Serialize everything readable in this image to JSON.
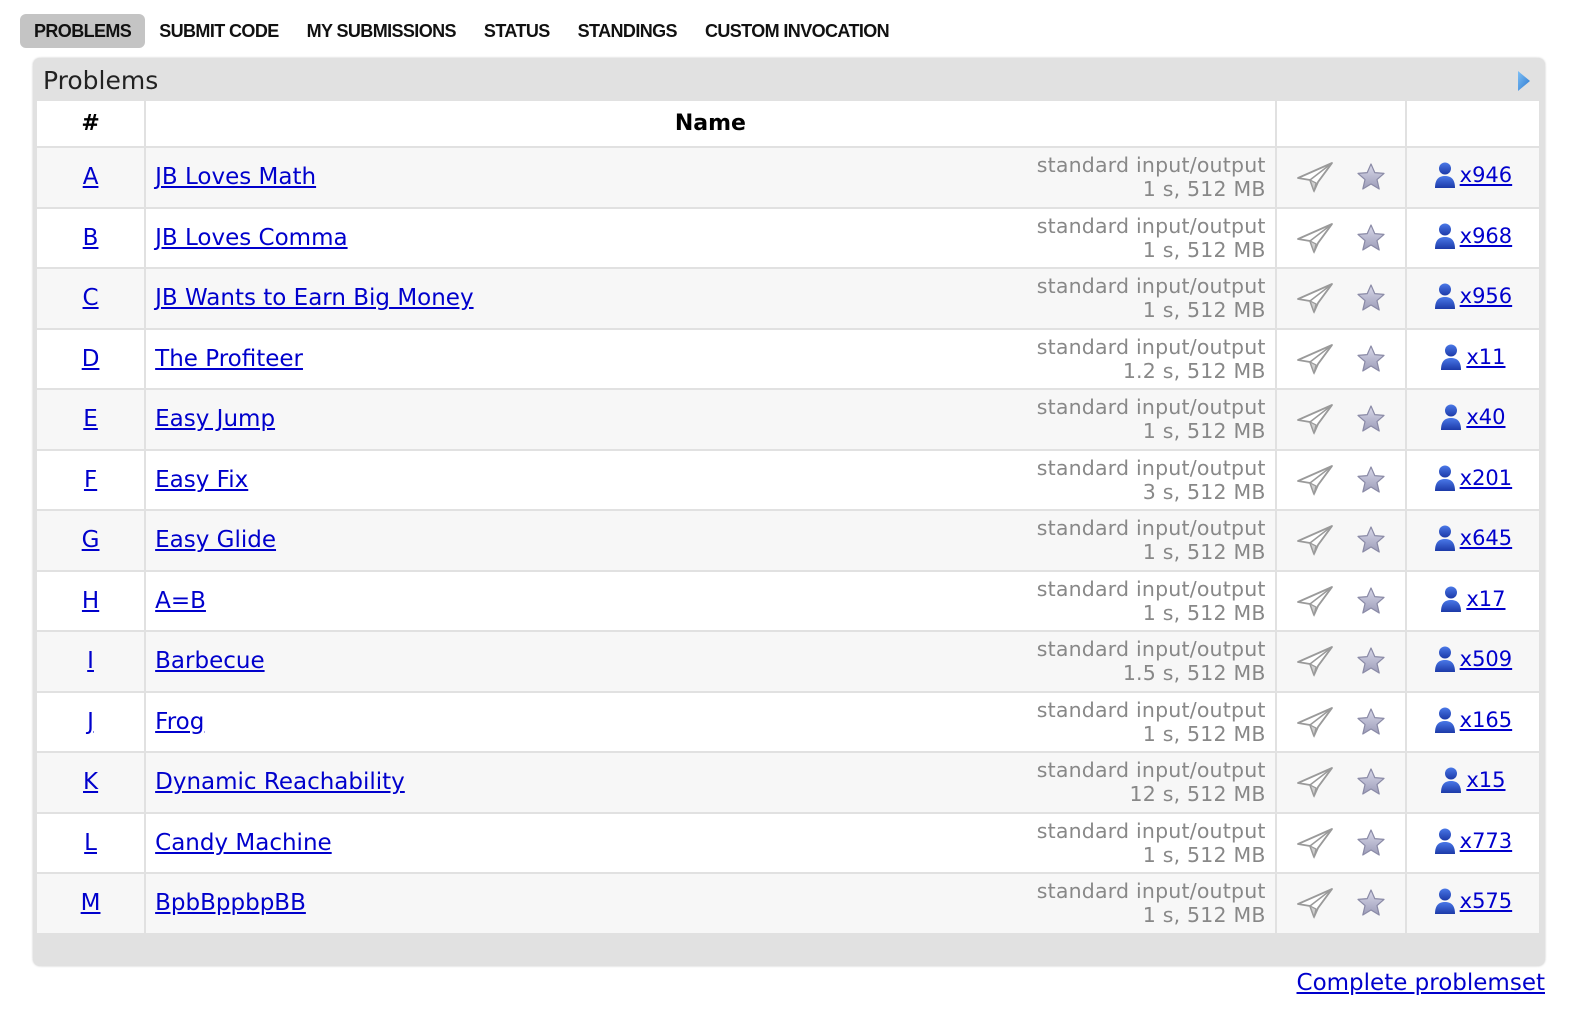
{
  "nav": {
    "items": [
      {
        "label": "PROBLEMS",
        "active": true
      },
      {
        "label": "SUBMIT CODE",
        "active": false
      },
      {
        "label": "MY SUBMISSIONS",
        "active": false
      },
      {
        "label": "STATUS",
        "active": false
      },
      {
        "label": "STANDINGS",
        "active": false
      },
      {
        "label": "CUSTOM INVOCATION",
        "active": false
      }
    ]
  },
  "panel": {
    "title": "Problems",
    "toggle_icon": "triangle-right-icon",
    "toggle_color": "#3b8ee0"
  },
  "table": {
    "headers": {
      "index": "#",
      "name": "Name",
      "actions": "",
      "solved": ""
    },
    "rows": [
      {
        "index": "A",
        "name": "JB Loves Math",
        "io": "standard input/output",
        "limits": "1 s, 512 MB",
        "solved": "x946"
      },
      {
        "index": "B",
        "name": "JB Loves Comma",
        "io": "standard input/output",
        "limits": "1 s, 512 MB",
        "solved": "x968"
      },
      {
        "index": "C",
        "name": "JB Wants to Earn Big Money",
        "io": "standard input/output",
        "limits": "1 s, 512 MB",
        "solved": "x956"
      },
      {
        "index": "D",
        "name": "The Profiteer",
        "io": "standard input/output",
        "limits": "1.2 s, 512 MB",
        "solved": "x11"
      },
      {
        "index": "E",
        "name": "Easy Jump",
        "io": "standard input/output",
        "limits": "1 s, 512 MB",
        "solved": "x40"
      },
      {
        "index": "F",
        "name": "Easy Fix",
        "io": "standard input/output",
        "limits": "3 s, 512 MB",
        "solved": "x201"
      },
      {
        "index": "G",
        "name": "Easy Glide",
        "io": "standard input/output",
        "limits": "1 s, 512 MB",
        "solved": "x645"
      },
      {
        "index": "H",
        "name": "A=B",
        "io": "standard input/output",
        "limits": "1 s, 512 MB",
        "solved": "x17"
      },
      {
        "index": "I",
        "name": "Barbecue",
        "io": "standard input/output",
        "limits": "1.5 s, 512 MB",
        "solved": "x509"
      },
      {
        "index": "J",
        "name": "Frog",
        "io": "standard input/output",
        "limits": "1 s, 512 MB",
        "solved": "x165"
      },
      {
        "index": "K",
        "name": "Dynamic Reachability",
        "io": "standard input/output",
        "limits": "12 s, 512 MB",
        "solved": "x15"
      },
      {
        "index": "L",
        "name": "Candy Machine",
        "io": "standard input/output",
        "limits": "1 s, 512 MB",
        "solved": "x773"
      },
      {
        "index": "M",
        "name": "BpbBppbpBB",
        "io": "standard input/output",
        "limits": "1 s, 512 MB",
        "solved": "x575"
      }
    ],
    "row_icons": {
      "submit": "paper-plane-icon",
      "favourite": "star-icon",
      "solved": "user-icon"
    }
  },
  "footer": {
    "complete_problemset": "Complete problemset"
  },
  "colors": {
    "link": "#0000cc",
    "panel_bg": "#e1e1e1",
    "active_tab_bg": "#c4c4c4",
    "muted_text": "#888888",
    "user_icon": "#2a4fc6"
  }
}
